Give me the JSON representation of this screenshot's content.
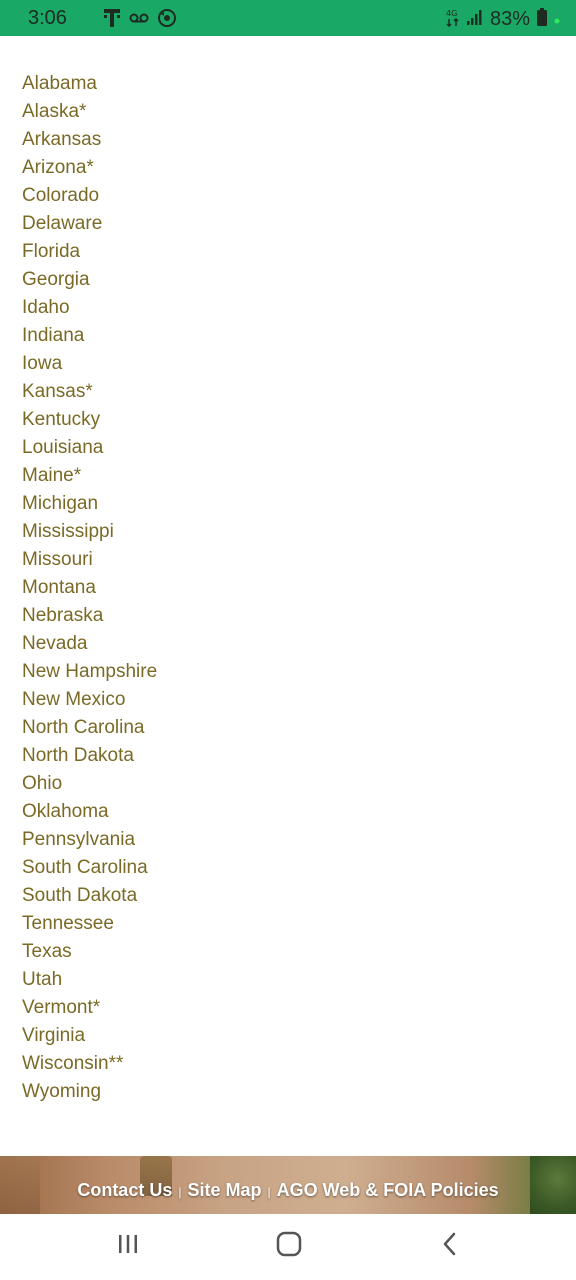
{
  "status_bar": {
    "time": "3:06",
    "carrier_icon": "t-mobile-icon",
    "voicemail_icon": "voicemail-icon",
    "sync_icon": "sync-icon",
    "data_icon": "lte-data-icon",
    "signal_icon": "signal-bars-icon",
    "battery_percent": "83%",
    "battery_icon": "battery-icon",
    "background_color": "#1aa866"
  },
  "states": [
    "Alabama",
    "Alaska*",
    "Arkansas",
    "Arizona*",
    "Colorado",
    "Delaware",
    "Florida",
    "Georgia",
    "Idaho",
    "Indiana",
    "Iowa",
    "Kansas*",
    "Kentucky",
    "Louisiana",
    "Maine*",
    "Michigan",
    "Mississippi",
    "Missouri",
    "Montana",
    "Nebraska",
    "Nevada",
    "New Hampshire",
    "New Mexico",
    "North Carolina",
    "North Dakota",
    "Ohio",
    "Oklahoma",
    "Pennsylvania",
    "South Carolina",
    "South Dakota",
    "Tennessee",
    "Texas",
    "Utah",
    "Vermont*",
    "Virginia",
    "Wisconsin**",
    "Wyoming"
  ],
  "link_color": "#7a6a26",
  "footer": {
    "contact_label": "Contact Us",
    "sitemap_label": "Site Map",
    "policies_label": "AGO Web & FOIA Policies",
    "separator": "|"
  },
  "nav_bar": {
    "recents_icon": "recents-icon",
    "home_icon": "home-icon",
    "back_icon": "back-icon"
  }
}
